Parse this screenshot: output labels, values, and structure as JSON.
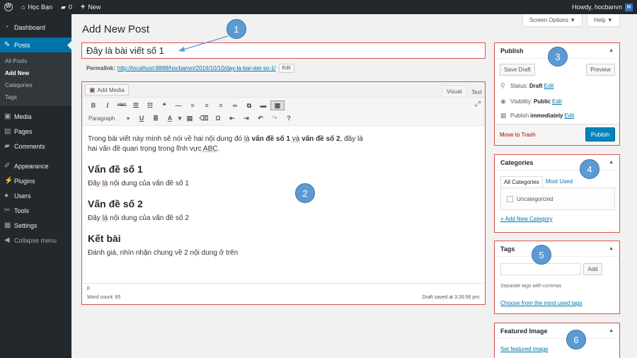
{
  "adminbar": {
    "site_name": "Học Bạn",
    "comments_count": "0",
    "new_label": "New",
    "howdy": "Howdy, hocbanvn",
    "avatar_text": "H"
  },
  "sidebar": {
    "items": [
      {
        "label": "Dashboard",
        "icon": "dashboard-icon"
      },
      {
        "label": "Posts",
        "icon": "pin-icon"
      },
      {
        "label": "Media",
        "icon": "media-icon"
      },
      {
        "label": "Pages",
        "icon": "pages-icon"
      },
      {
        "label": "Comments",
        "icon": "comments-icon"
      },
      {
        "label": "Appearance",
        "icon": "appearance-icon"
      },
      {
        "label": "Plugins",
        "icon": "plugins-icon"
      },
      {
        "label": "Users",
        "icon": "users-icon"
      },
      {
        "label": "Tools",
        "icon": "tools-icon"
      },
      {
        "label": "Settings",
        "icon": "settings-icon"
      },
      {
        "label": "Collapse menu",
        "icon": "collapse-icon"
      }
    ],
    "posts_submenu": [
      "All Posts",
      "Add New",
      "Categories",
      "Tags"
    ]
  },
  "screen_options_label": "Screen Options ▼",
  "help_label": "Help ▼",
  "page_title": "Add New Post",
  "post": {
    "title": "Đây là bài viết số 1",
    "permalink_label": "Permalink:",
    "permalink_url": "http://localhost:8888/hocbanvn/2016/10/10/day-la-bai-viet-so-1/",
    "edit_label": "Edit"
  },
  "editor": {
    "add_media_label": "Add Media",
    "tab_visual": "Visual",
    "tab_text": "Text",
    "paragraph_select": "Paragraph",
    "intro_1": "Trong bài viết này mình sẽ nói về hai nội dung đó ",
    "intro_la": "là",
    "intro_b1": "vấn đề số 1",
    "intro_va": "và",
    "intro_b2": "vấn đề số 2",
    "intro_2": ", đây là",
    "intro_3": "hai vấn đề quan trọng trong lĩnh vực ",
    "intro_abc": "ABC",
    "intro_dot": ".",
    "h1": "Vấn đề số 1",
    "p1_a": "Đây ",
    "p1_la": "là",
    "p1_b": " nội dung của vấn đề số 1",
    "h2": "Vấn đề số 2",
    "p2_a": "Đây ",
    "p2_la": "là",
    "p2_b": " nội dung của vấn đề số 2",
    "h3": "Kết bài",
    "p3": "Đánh giá, nhìn nhận chung về 2 nội dung ở trên",
    "path": "p",
    "word_count": "Word count: 65",
    "draft_saved": "Draft saved at 3:26:56 pm."
  },
  "publish": {
    "title": "Publish",
    "save_draft": "Save Draft",
    "preview": "Preview",
    "status_label": "Status:",
    "status_value": "Draft",
    "visibility_label": "Visibility:",
    "visibility_value": "Public",
    "publish_label": "Publish",
    "publish_value": "immediately",
    "edit_link": "Edit",
    "trash": "Move to Trash",
    "publish_button": "Publish"
  },
  "categories": {
    "title": "Categories",
    "tab_all": "All Categories",
    "tab_most_used": "Most Used",
    "items": [
      "Uncategorized"
    ],
    "add_new": "+ Add New Category"
  },
  "tags": {
    "title": "Tags",
    "input_value": "",
    "add_button": "Add",
    "hint": "Separate tags with commas",
    "choose_link": "Choose from the most used tags"
  },
  "featured": {
    "title": "Featured Image",
    "set_link": "Set featured image"
  },
  "callouts": [
    "1",
    "2",
    "3",
    "4",
    "5",
    "6"
  ]
}
